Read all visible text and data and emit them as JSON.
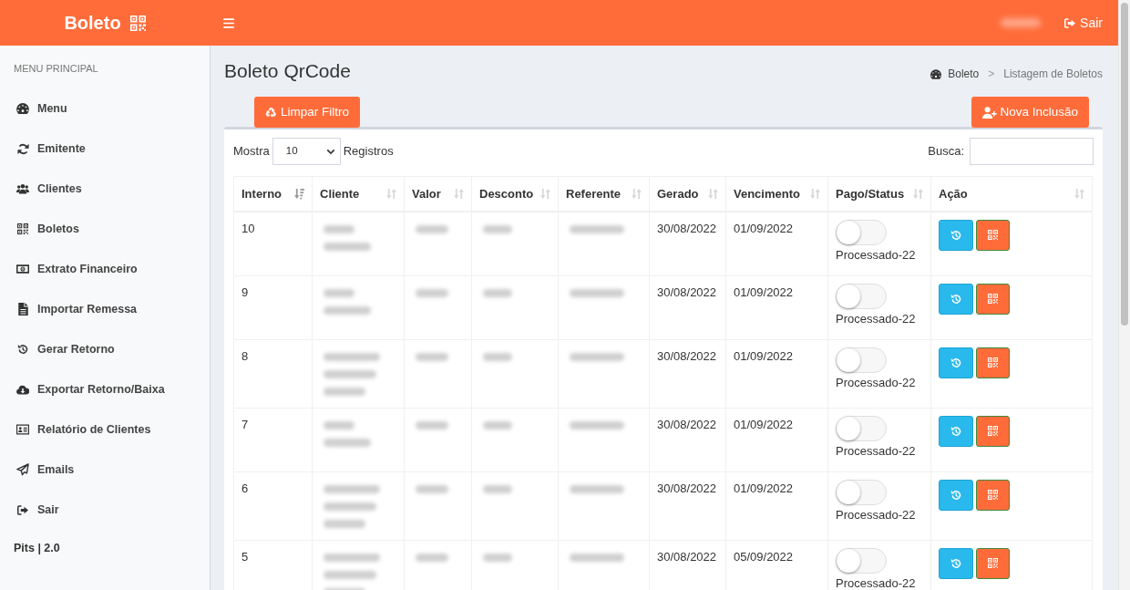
{
  "topbar": {
    "logo": "Boleto",
    "logout": "Sair"
  },
  "sidebar": {
    "heading": "MENU PRINCIPAL",
    "items": [
      "Menu",
      "Emitente",
      "Clientes",
      "Boletos",
      "Extrato Financeiro",
      "Importar Remessa",
      "Gerar Retorno",
      "Exportar Retorno/Baixa",
      "Relatório de Clientes",
      "Emails",
      "Sair"
    ],
    "footer": "Pits | 2.0"
  },
  "page": {
    "title": "Boleto QrCode",
    "breadcrumb": {
      "items": [
        "Boleto",
        "Listagem de Boletos"
      ],
      "separator": ">"
    }
  },
  "actions": {
    "clear_filter": "Limpar Filtro",
    "new_entry": "Nova Inclusão"
  },
  "table_controls": {
    "show_label": "Mostra",
    "page_size": "10",
    "records_label": "Registros",
    "search_label": "Busca:"
  },
  "table": {
    "columns": [
      {
        "label": "Interno",
        "sorted": true
      },
      {
        "label": "Cliente",
        "sorted": false
      },
      {
        "label": "Valor",
        "sorted": false
      },
      {
        "label": "Desconto",
        "sorted": false
      },
      {
        "label": "Referente",
        "sorted": false
      },
      {
        "label": "Gerado",
        "sorted": false
      },
      {
        "label": "Vencimento",
        "sorted": false
      },
      {
        "label": "Pago/Status",
        "sorted": false
      },
      {
        "label": "Ação",
        "sorted": false
      }
    ],
    "rows": [
      {
        "kind": "short",
        "interno": "10",
        "gerado": "30/08/2022",
        "vencimento": "01/09/2022",
        "pago": false,
        "status": "Processado-22"
      },
      {
        "kind": "short",
        "interno": "9",
        "gerado": "30/08/2022",
        "vencimento": "01/09/2022",
        "pago": false,
        "status": "Processado-22"
      },
      {
        "kind": "tall",
        "interno": "8",
        "gerado": "30/08/2022",
        "vencimento": "01/09/2022",
        "pago": false,
        "status": "Processado-22"
      },
      {
        "kind": "short",
        "interno": "7",
        "gerado": "30/08/2022",
        "vencimento": "01/09/2022",
        "pago": false,
        "status": "Processado-22"
      },
      {
        "kind": "tall",
        "interno": "6",
        "gerado": "30/08/2022",
        "vencimento": "01/09/2022",
        "pago": false,
        "status": "Processado-22"
      },
      {
        "kind": "tall",
        "interno": "5",
        "gerado": "30/08/2022",
        "vencimento": "05/09/2022",
        "pago": false,
        "status": "Processado-22"
      }
    ]
  }
}
